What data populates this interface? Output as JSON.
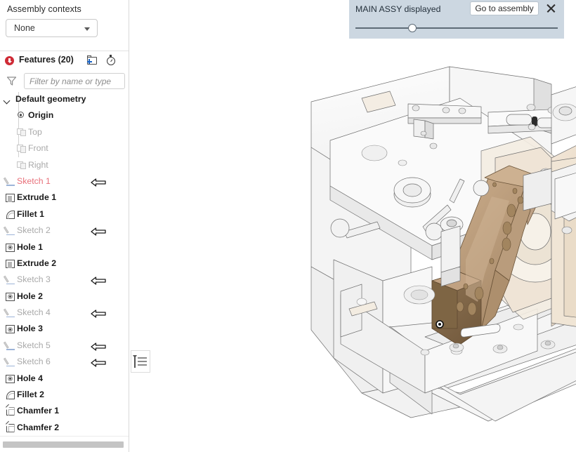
{
  "sidebar": {
    "assembly_contexts_label": "Assembly contexts",
    "context_select": {
      "value": "None",
      "caret_icon": "chevron-down-icon"
    },
    "features": {
      "title": "Features (20)",
      "warning_icon": "error-circle-icon",
      "new_folder_icon": "new-folder-icon",
      "history_icon": "stopwatch-icon"
    },
    "filter": {
      "icon": "funnel-icon",
      "placeholder": "Filter by name or type",
      "value": ""
    },
    "tree": [
      {
        "label": "Default geometry",
        "kind": "root",
        "icon": "chevron-expanded-icon",
        "state": "normal",
        "rollback": false
      },
      {
        "label": "Origin",
        "kind": "child",
        "icon": "origin-icon",
        "state": "normal",
        "rollback": false
      },
      {
        "label": "Top",
        "kind": "child",
        "icon": "plane-icon",
        "state": "muted",
        "rollback": false
      },
      {
        "label": "Front",
        "kind": "child",
        "icon": "plane-icon",
        "state": "muted",
        "rollback": false
      },
      {
        "label": "Right",
        "kind": "child",
        "icon": "plane-icon",
        "state": "muted",
        "rollback": false
      },
      {
        "label": "Sketch 1",
        "kind": "feature",
        "icon": "sketch-icon",
        "state": "red",
        "rollback": true
      },
      {
        "label": "Extrude 1",
        "kind": "feature",
        "icon": "extrude-icon",
        "state": "normal",
        "rollback": false
      },
      {
        "label": "Fillet 1",
        "kind": "feature",
        "icon": "fillet-icon",
        "state": "normal",
        "rollback": false
      },
      {
        "label": "Sketch 2",
        "kind": "feature",
        "icon": "sketch-icon",
        "state": "muted",
        "rollback": true
      },
      {
        "label": "Hole 1",
        "kind": "feature",
        "icon": "hole-icon",
        "state": "normal",
        "rollback": false
      },
      {
        "label": "Extrude 2",
        "kind": "feature",
        "icon": "extrude-icon",
        "state": "normal",
        "rollback": false
      },
      {
        "label": "Sketch 3",
        "kind": "feature",
        "icon": "sketch-icon",
        "state": "muted",
        "rollback": true
      },
      {
        "label": "Hole 2",
        "kind": "feature",
        "icon": "hole-icon",
        "state": "normal",
        "rollback": false
      },
      {
        "label": "Sketch 4",
        "kind": "feature",
        "icon": "sketch-icon",
        "state": "muted",
        "rollback": true
      },
      {
        "label": "Hole 3",
        "kind": "feature",
        "icon": "hole-icon",
        "state": "normal",
        "rollback": false
      },
      {
        "label": "Sketch 5",
        "kind": "feature",
        "icon": "sketch-icon",
        "state": "muted",
        "rollback": true
      },
      {
        "label": "Sketch 6",
        "kind": "feature",
        "icon": "sketch-icon",
        "state": "muted",
        "rollback": true
      },
      {
        "label": "Hole 4",
        "kind": "feature",
        "icon": "hole-icon",
        "state": "normal",
        "rollback": false
      },
      {
        "label": "Fillet 2",
        "kind": "feature",
        "icon": "fillet-icon",
        "state": "normal",
        "rollback": false
      },
      {
        "label": "Chamfer 1",
        "kind": "feature",
        "icon": "chamfer-icon",
        "state": "normal",
        "rollback": false
      },
      {
        "label": "Chamfer 2",
        "kind": "feature",
        "icon": "chamfer-icon",
        "state": "normal",
        "rollback": false
      }
    ],
    "horizontal_scrollbar": "horizontal-scrollbar"
  },
  "banner": {
    "message": "MAIN ASSY displayed",
    "action_label": "Go to assembly",
    "close_icon": "close-icon",
    "slider": {
      "position_percent": 28,
      "handle_icon": "slider-handle"
    },
    "background_color": "#ccd7e1"
  },
  "viewport": {
    "panel_toggle_icon": "list-panel-toggle-icon",
    "background_color": "#ffffff",
    "model": {
      "description": "3D CAD assembly view",
      "active_part_color": "#c4a584",
      "body_color": "#f2f2f2",
      "secondary_part_color": "#efe4d6"
    }
  }
}
